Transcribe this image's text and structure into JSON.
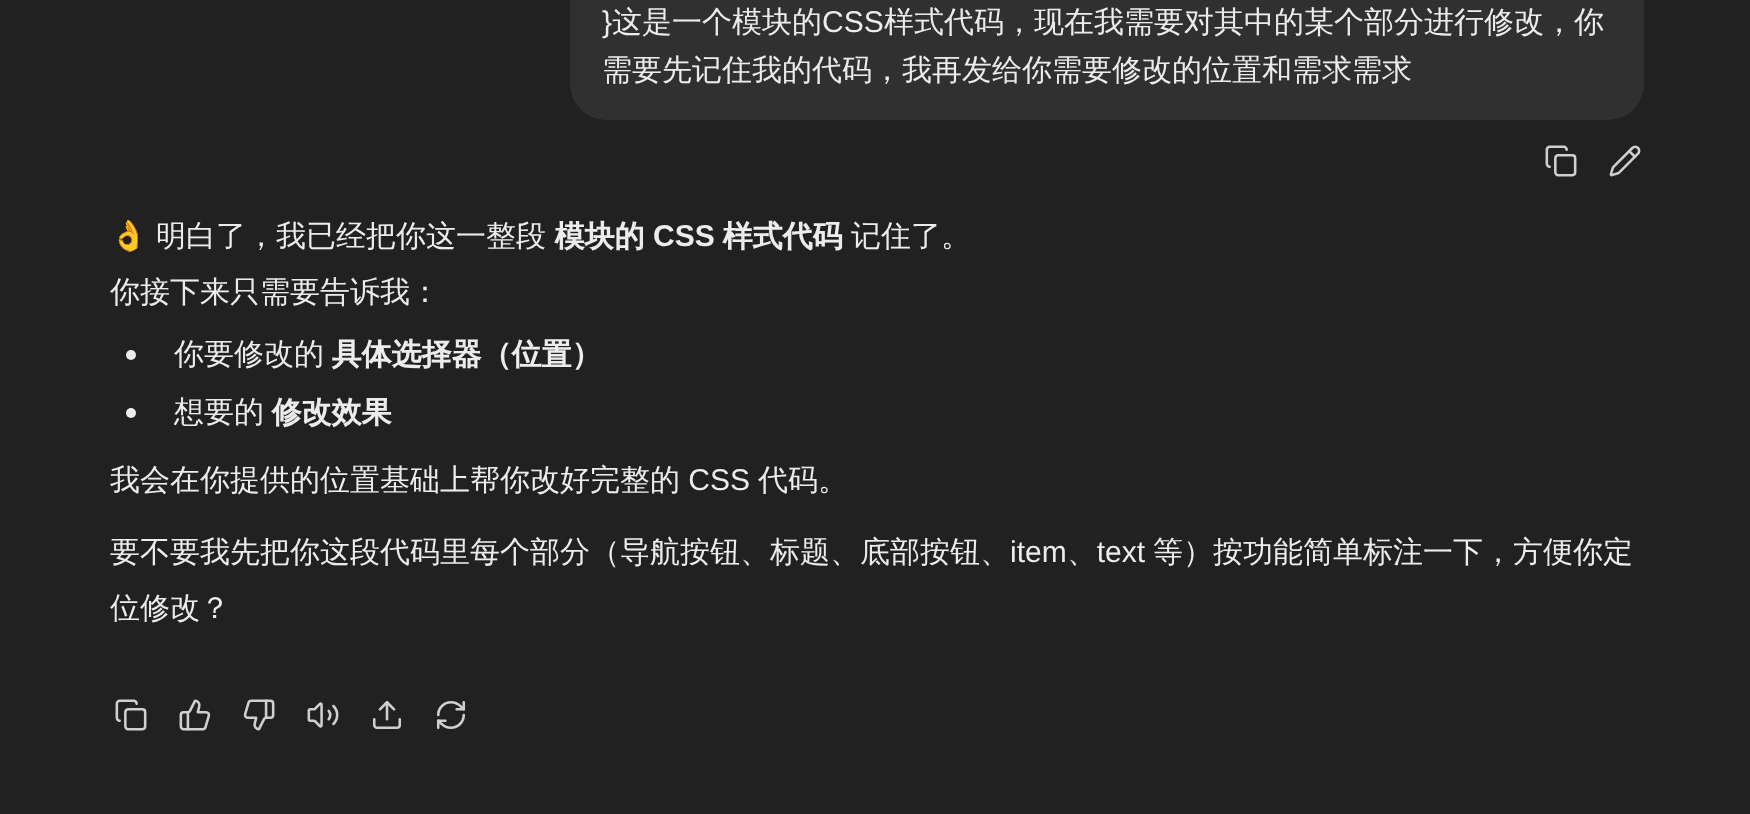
{
  "user_message": {
    "text": "}这是一个模块的CSS样式代码，现在我需要对其中的某个部分进行修改，你需要先记住我的代码，我再发给你需要修改的位置和需求需求"
  },
  "user_actions": [
    {
      "kind": "copy"
    },
    {
      "kind": "edit"
    }
  ],
  "reply": {
    "paragraphs": [
      {
        "text": "👌 明白了，我已经把你这一整段 **模块的 CSS 样式代码** 记住了。"
      },
      {
        "text": "你接下来只需要告诉我："
      }
    ],
    "bullets": [
      {
        "text": "你要修改的 **具体选择器（位置）**"
      },
      {
        "text": "想要的 **修改效果**"
      }
    ],
    "closing": [
      {
        "text": "我会在你提供的位置基础上帮你改好完整的 CSS 代码。"
      },
      {
        "text": "要不要我先把你这段代码里每个部分（导航按钮、标题、底部按钮、item、text 等）按功能简单标注一下，方便你定位修改？"
      }
    ]
  },
  "reply_actions": [
    {
      "kind": "copy"
    },
    {
      "kind": "like"
    },
    {
      "kind": "dislike"
    },
    {
      "kind": "read-aloud"
    },
    {
      "kind": "share"
    },
    {
      "kind": "regenerate"
    }
  ]
}
